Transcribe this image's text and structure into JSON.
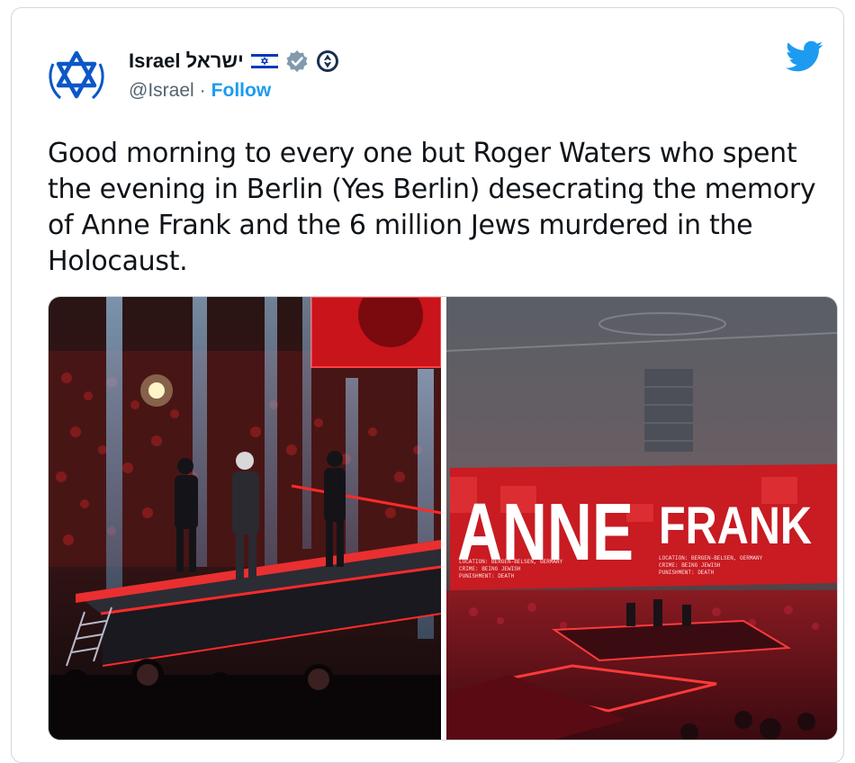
{
  "tweet": {
    "display_name": "Israel ישראל",
    "handle": "@Israel",
    "separator": "·",
    "follow_label": "Follow",
    "text": "Good morning to every one but Roger Waters who spent the evening in Berlin (Yes Berlin) desecrating the memory of Anne Frank and the 6 million Jews murdered in the Holocaust."
  },
  "icons": {
    "avatar": "star-of-david-icon",
    "flag": "israel-flag-icon",
    "verified": "verified-badge-icon",
    "seal": "government-seal-icon",
    "brand": "twitter-bird-icon"
  },
  "media": {
    "right_photo": {
      "screen_word_1": "ANNE",
      "screen_word_2": "FRANK",
      "caption_left": "LOCATION: BERGEN-BELSEN, GERMANY\nCRIME: BEING JEWISH\nPUNISHMENT: DEATH",
      "caption_right": "LOCATION: BERGEN-BELSEN, GERMANY\nCRIME: BEING JEWISH\nPUNISHMENT: DEATH"
    }
  },
  "colors": {
    "link": "#1d9bf0",
    "text": "#0f1419",
    "muted": "#536471",
    "twitter_blue": "#1d9bf0",
    "flag_blue": "#0038b8",
    "stage_red": "#d9141b"
  }
}
